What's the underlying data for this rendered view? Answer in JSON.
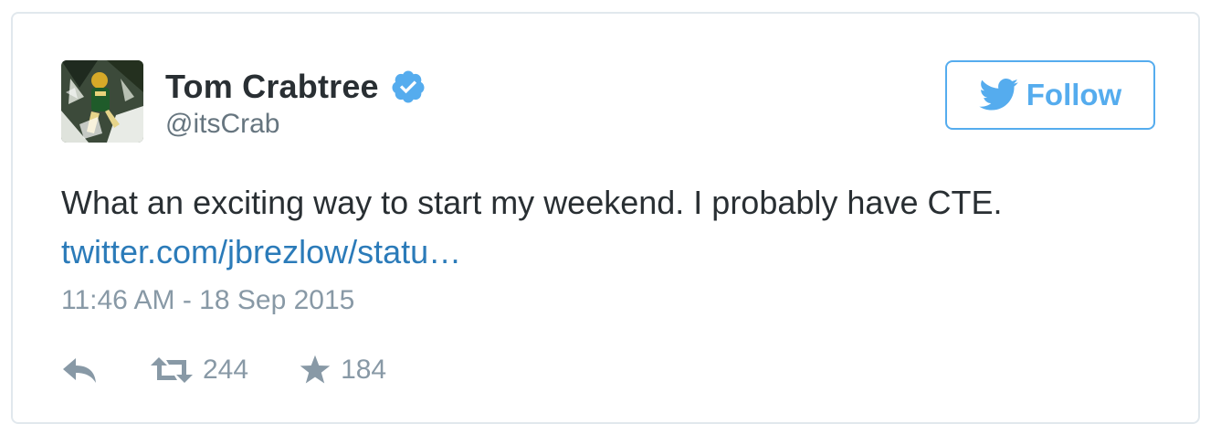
{
  "tweet": {
    "author": {
      "display_name": "Tom Crabtree",
      "handle": "@itsCrab",
      "verified": true,
      "avatar_icon": "avatar-photo"
    },
    "follow_button": {
      "label": "Follow",
      "icon": "twitter-bird-icon"
    },
    "text": "What an exciting way to start my weekend. I probably have CTE.",
    "link": "twitter.com/jbrezlow/statu…",
    "timestamp": "11:46 AM - 18 Sep 2015",
    "actions": {
      "reply_icon": "reply-icon",
      "retweet_icon": "retweet-icon",
      "retweet_count": "244",
      "favorite_icon": "star-icon",
      "favorite_count": "184"
    }
  },
  "colors": {
    "text_primary": "#292f33",
    "text_secondary": "#66757f",
    "text_muted": "#8899a6",
    "link": "#2b7bb9",
    "accent": "#55acee",
    "border": "#e1e8ed"
  }
}
